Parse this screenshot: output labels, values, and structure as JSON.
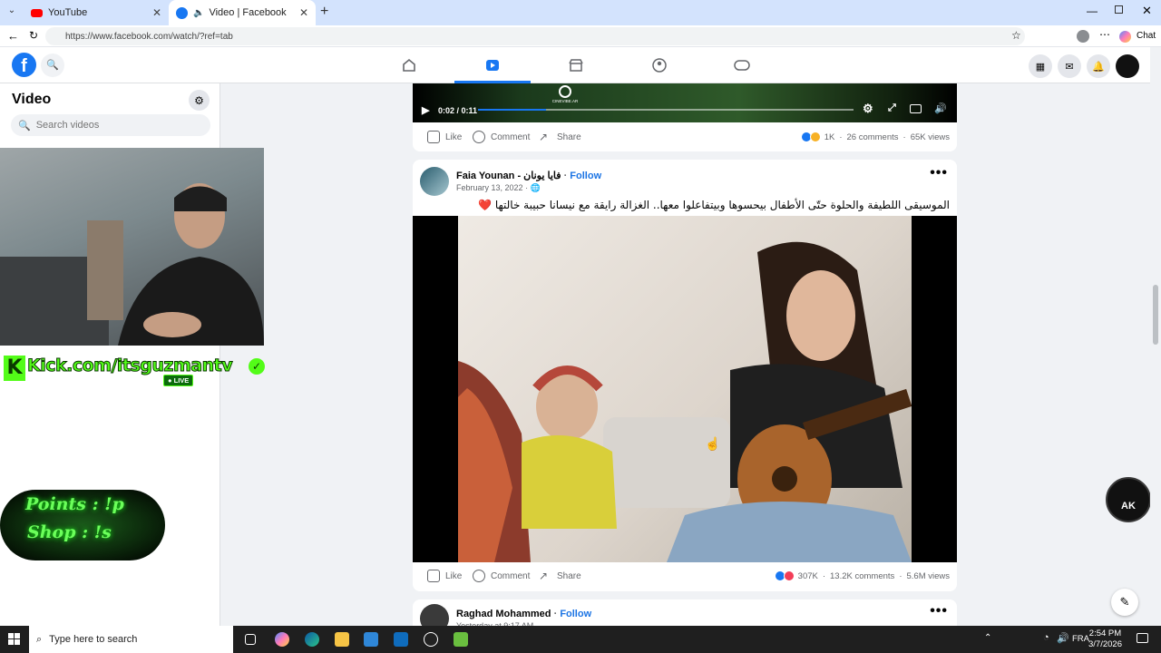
{
  "browser": {
    "tabs": [
      {
        "label": "YouTube"
      },
      {
        "label": "Video | Facebook"
      }
    ],
    "url": "https://www.facebook.com/watch/?ref=tab",
    "chat_label": "Chat",
    "colors": {
      "tabstrip": "#d3e3fd",
      "fb_blue": "#1b74e4"
    }
  },
  "sidebar": {
    "title": "Video",
    "search_placeholder": "Search videos"
  },
  "stream_overlay": {
    "kick_text": "Kick.com/itsguzmantv",
    "live_badge": "LIVE",
    "points_line": "Points : !p",
    "shop_line": "Shop : !s",
    "badge_text": "AK"
  },
  "feed": {
    "post1": {
      "time": "0:02 / 0:11",
      "cinevibe": "CINEVIBE.AR",
      "like": "Like",
      "comment": "Comment",
      "share": "Share",
      "reactions": "1K",
      "comments": "26 comments",
      "views": "65K views",
      "progress_fraction": 0.18
    },
    "post2": {
      "author": "Faia Younan - فايا يونان",
      "follow": "Follow",
      "date": "February 13, 2022",
      "caption": "الموسيقى اللطيفة والحلوة حتّى الأطفال بيحسوها وبيتفاعلوا معها.. الغزالة رايقة مع نيسانا حبيبة خالتها ❤️",
      "like": "Like",
      "comment": "Comment",
      "share": "Share",
      "reactions": "307K",
      "comments": "13.2K comments",
      "views": "5.6M views"
    },
    "post3": {
      "author": "Raghad Mohammed",
      "follow": "Follow",
      "date": "Yesterday at 9:17 AM"
    }
  },
  "taskbar": {
    "search_placeholder": "Type here to search",
    "lang": "FRA",
    "time": "2:54 PM",
    "date": "3/7/2026"
  }
}
